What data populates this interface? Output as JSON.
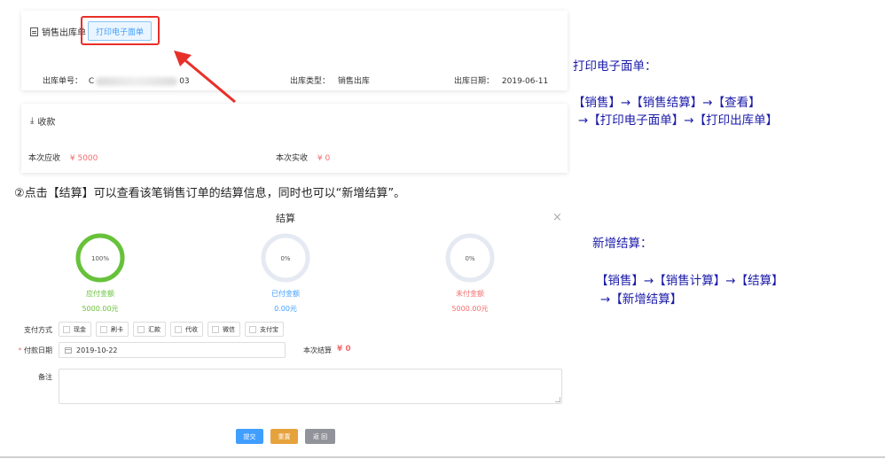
{
  "outbound": {
    "title": "销售出库单",
    "print_button": "打印电子面单",
    "order_no_label": "出库单号：",
    "order_no_prefix": "C",
    "order_no_suffix": "03",
    "type_label": "出库类型：",
    "type_value": "销售出库",
    "date_label": "出库日期：",
    "date_value": "2019-06-11"
  },
  "collection": {
    "title": "收款",
    "due_label": "本次应收",
    "due_value": "¥ 5000",
    "actual_label": "本次实收",
    "actual_value": "¥ 0"
  },
  "instruction": "②点击【结算】可以查看该笔销售订单的结算信息，同时也可以“新增结算”。",
  "dialog": {
    "title": "结算",
    "close": "×",
    "rings": [
      {
        "percent_text": "100%",
        "fraction": 1.0,
        "label": "应付金额",
        "value": "5000.00元",
        "color": "#67c23a"
      },
      {
        "percent_text": "0%",
        "fraction": 0.0,
        "label": "已付金额",
        "value": "0.00元",
        "color": "#409eff"
      },
      {
        "percent_text": "0%",
        "fraction": 0.0,
        "label": "未付金额",
        "value": "5000.00元",
        "color": "#f56c6c"
      }
    ],
    "pay_method_label": "支付方式",
    "pay_methods": [
      "现金",
      "刷卡",
      "汇款",
      "代收",
      "微信",
      "支付宝"
    ],
    "pay_date_required": "*",
    "pay_date_label": "付款日期",
    "pay_date_value": "2019-10-22",
    "settle_label": "本次结算",
    "settle_value": "¥ 0",
    "remark_label": "备注",
    "submit": "提交",
    "reset": "重置",
    "back": "返 回"
  },
  "notes": {
    "print_title": "打印电子面单：",
    "print_path_1": "【销售】→【销售结算】→【查看】",
    "print_path_2": "→【打印电子面单】→【打印出库单】",
    "add_title": "新增结算：",
    "add_path_1": "【销售】→【销售计算】→【结算】",
    "add_path_2": "→【新增结算】"
  },
  "colors": {
    "accent": "#409eff",
    "annotation": "#e8302a",
    "note_text": "#1a1aa8"
  }
}
